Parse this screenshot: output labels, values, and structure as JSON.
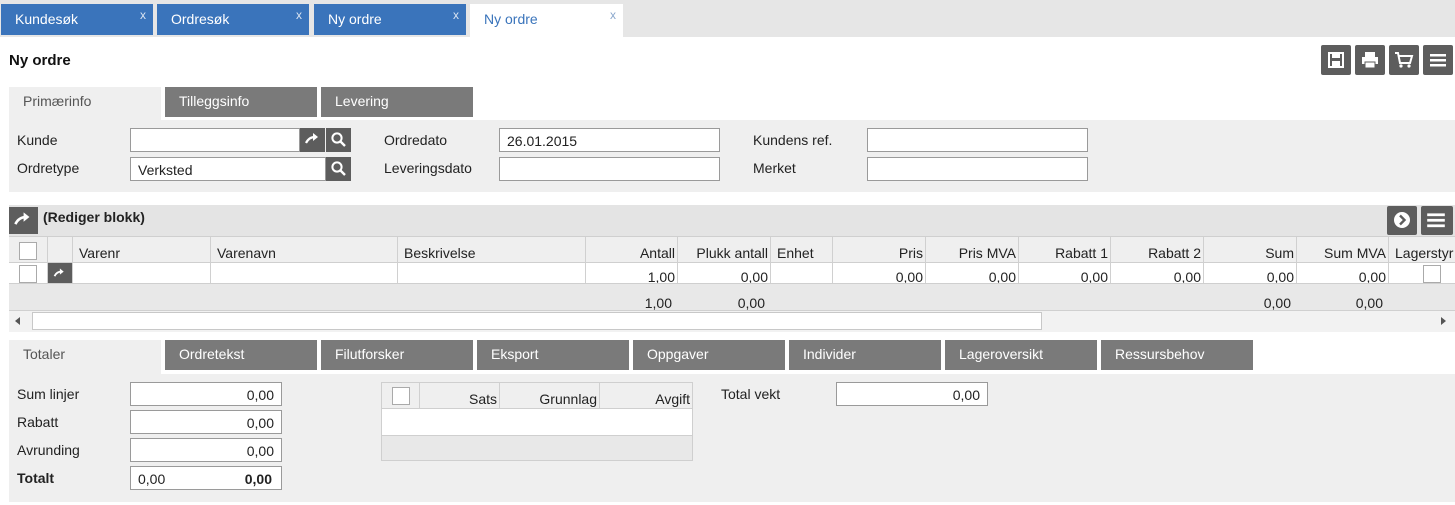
{
  "top_tabs": [
    {
      "label": "Kundesøk",
      "close": "x"
    },
    {
      "label": "Ordresøk",
      "close": "x"
    },
    {
      "label": "Ny ordre",
      "close": "x"
    },
    {
      "label": "Ny ordre",
      "close": "x"
    }
  ],
  "page_title": "Ny ordre",
  "order_tabs": [
    "Primærinfo",
    "Tilleggsinfo",
    "Levering"
  ],
  "primary": {
    "kunde_label": "Kunde",
    "kunde_value": "",
    "ordretype_label": "Ordretype",
    "ordretype_value": "Verksted",
    "ordredato_label": "Ordredato",
    "ordredato_value": "26.01.2015",
    "leveringsdato_label": "Leveringsdato",
    "leveringsdato_value": "",
    "kundens_ref_label": "Kundens ref.",
    "kundens_ref_value": "",
    "merket_label": "Merket",
    "merket_value": ""
  },
  "grid": {
    "title": "(Rediger blokk)",
    "columns": [
      "Varenr",
      "Varenavn",
      "Beskrivelse",
      "Antall",
      "Plukk antall",
      "Enhet",
      "Pris",
      "Pris MVA",
      "Rabatt 1",
      "Rabatt 2",
      "Sum",
      "Sum MVA",
      "Lagerstyr"
    ],
    "row": {
      "antall": "1,00",
      "plukk": "0,00",
      "pris": "0,00",
      "pris_mva": "0,00",
      "rabatt1": "0,00",
      "rabatt2": "0,00",
      "sum": "0,00",
      "sum_mva": "0,00"
    },
    "totals": {
      "antall": "1,00",
      "plukk": "0,00",
      "sum": "0,00",
      "sum_mva": "0,00"
    }
  },
  "bottom_tabs": [
    "Totaler",
    "Ordretekst",
    "Filutforsker",
    "Eksport",
    "Oppgaver",
    "Individer",
    "Lageroversikt",
    "Ressursbehov"
  ],
  "totals": {
    "sum_linjer_label": "Sum linjer",
    "sum_linjer": "0,00",
    "rabatt_label": "Rabatt",
    "rabatt": "0,00",
    "avrunding_label": "Avrunding",
    "avrunding": "0,00",
    "totalt_label": "Totalt",
    "totalt_left": "0,00",
    "totalt_right": "0,00",
    "tax_columns": [
      "Sats",
      "Grunnlag",
      "Avgift"
    ],
    "total_vekt_label": "Total vekt",
    "total_vekt": "0,00"
  },
  "colors": {
    "tab_blue": "#3a74bb",
    "dark_button": "#5d5d5d",
    "inactive_tab": "#7a7a7a"
  }
}
